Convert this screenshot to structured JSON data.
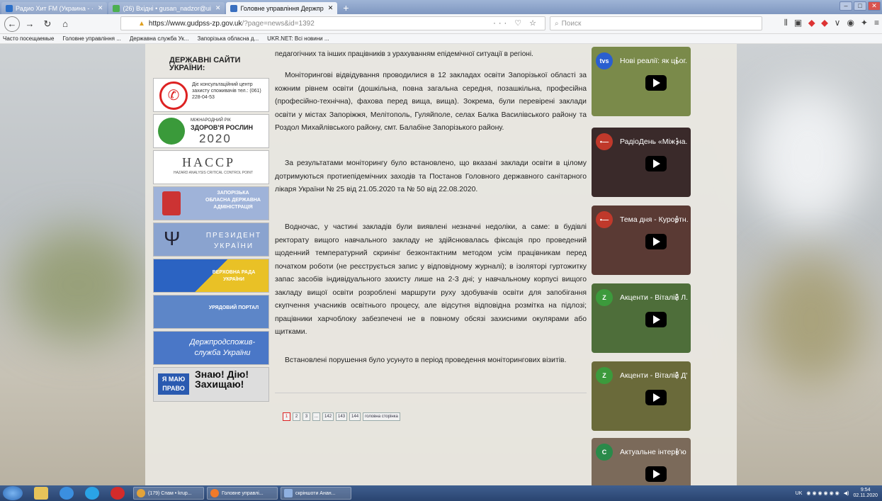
{
  "browser": {
    "tabs": [
      {
        "label": "Радио Хит FM (Украина - ·",
        "icon_color": "#2a6fc9",
        "active": false
      },
      {
        "label": "(26) Вхідні • gusan_nadzor@ui",
        "icon_color": "#4caf50",
        "active": false
      },
      {
        "label": "Головне управління Держпр",
        "icon_color": "#3a6fbf",
        "active": true
      }
    ],
    "url_host": "https://www.gudpss-zp.gov.uk",
    "url_path": "/?page=news&id=1392",
    "search_placeholder": "Поиск",
    "bookmarks": [
      "Часто посещаемые",
      "Головне управління ...",
      "Державна служба Ук...",
      "Запорізька обласна д...",
      "UKR.NET: Всі новини ..."
    ]
  },
  "sidebar": {
    "title": "ДЕРЖАВНІ САЙТИ УКРАЇНИ:",
    "banners": {
      "consult": "Діє консультаційний центр захисту споживачів тел.: (061) 228-04-53",
      "plants_small": "МІЖНАРОДНИЙ РІК",
      "plants": "ЗДОРОВ'Я РОСЛИН",
      "plants_year": "2020",
      "haccp": "HACCP",
      "haccp_sub": "HAZARD ANALYSIS CRITICAL CONTROL POINT",
      "oda": "ЗАПОРІЗЬКА ОБЛАСНА ДЕРЖАВНА АДМІНІСТРАЦІЯ",
      "president": "ПРЕЗИДЕНТ УКРАЇНИ",
      "rada": "ВЕРХОВНА РАДА УКРАЇНИ",
      "gov": "УРЯДОВИЙ ПОРТАЛ",
      "dpss": "Держпродспожив-служба України",
      "rights_label": "Я МАЮ ПРАВО",
      "rights": "Знаю! Дію! Захищаю!"
    }
  },
  "article": {
    "top_fragment": "педагогічних та інших працівників з урахуванням епідемічної ситуації в регіоні.",
    "p1": "Моніторингові відвідування проводилися в 12 закладах освіти Запорізької області за кожним рівнем освіти (дошкільна, повна загальна середня, позашкільна, професійна (професійно-технічна), фахова перед вища, вища). Зокрема, були перевірені заклади освіти у містах Запоріжжя, Мелітополь, Гуляйполе, селах Балка Василівського району та Роздол Михайлівського району, смт. Балабіне Запорізького району.",
    "p2": "За результатами моніторингу було встановлено, що вказані заклади освіти в цілому дотримуються протиепідемічних заходів та Постанов Головного державного санітарного лікаря України № 25 від 21.05.2020 та № 50 від 22.08.2020.",
    "p3": "Водночас, у частині закладів були виявлені незначні недоліки, а саме: в будівлі ректорату вищого навчального закладу не здійснювалась фіксація про проведений щоденний температурний скринінг безконтактним методом усім працівникам перед початком роботи (не реєструється запис у відповідному журналі); в ізоляторі гуртожитку запас засобів індивідуального захисту лише на 2-3 дні; у навчальному корпусі вищого закладу вищої освіти розроблені маршрути руху здобувачів освіти для запобігання скупчення учасників освітнього процесу, але відсутня відповідна розмітка на підлозі; працівники харчоблоку забезпечені не в повному обсязі захисними окулярами або щитками.",
    "p4": "Встановлені порушення було усунуто в період проведення моніторингових візитів."
  },
  "pagination": [
    "1",
    "2",
    "3",
    "...",
    "142",
    "143",
    "144",
    "головна сторінка"
  ],
  "videos": [
    {
      "title": "Нові реалії: як цьог...",
      "channel": "tvs",
      "bg": "#7a8a4a",
      "chan_color": "#2a5fd0"
    },
    {
      "title": "РадіоДень «Між на...",
      "channel": "•—",
      "bg": "#3a2a2a",
      "chan_color": "#c0392b"
    },
    {
      "title": "Тема дня - Курортн...",
      "channel": "•—",
      "bg": "#5a3a34",
      "chan_color": "#c0392b"
    },
    {
      "title": "Акценти - Віталій Л...",
      "channel": "Z",
      "bg": "#4e6e3a",
      "chan_color": "#3c9a3c"
    },
    {
      "title": "Акценти - Віталій Д'...",
      "channel": "Z",
      "bg": "#6a6a3a",
      "chan_color": "#3c9a3c"
    },
    {
      "title": "Актуальне інтерв'ю",
      "channel": "C",
      "bg": "#7b6a5a",
      "chan_color": "#2a8a4a"
    }
  ],
  "taskbar": {
    "tasks": [
      "(179) Спам • krup...",
      "Головне управлі...",
      "скріншоти Анан..."
    ],
    "lang": "UK",
    "time": "9:54",
    "date": "02.11.2020"
  }
}
